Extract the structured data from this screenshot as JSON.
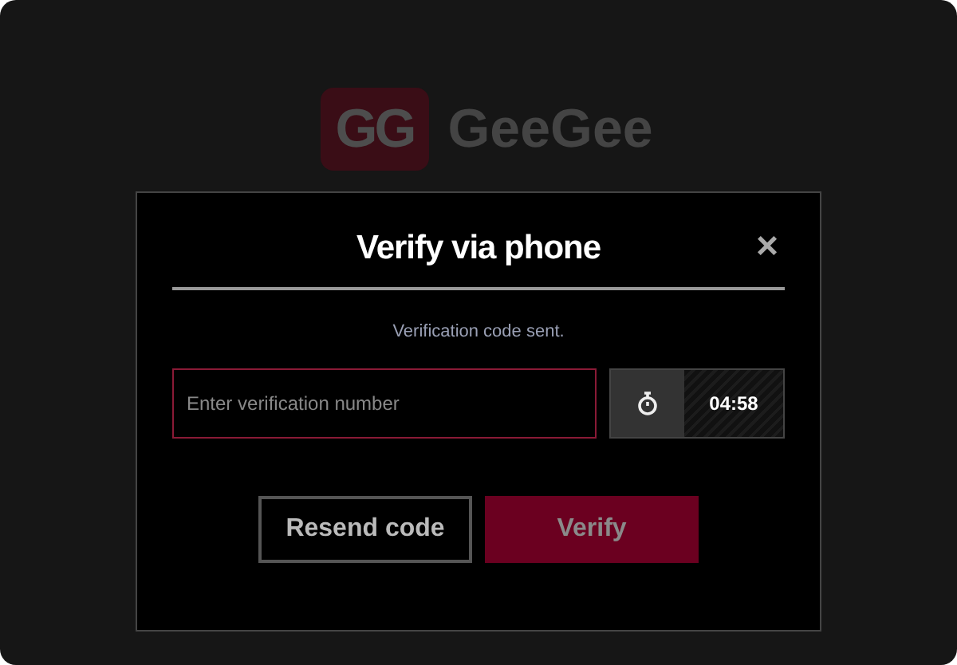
{
  "logo": {
    "mark": "GG",
    "name": "GeeGee"
  },
  "dialog": {
    "title": "Verify via phone",
    "close": "×",
    "message": "Verification code sent.",
    "code_field": {
      "placeholder": "Enter verification number"
    },
    "timer": "04:58",
    "buttons": [
      {
        "kind": "secondary",
        "label": "Resend code",
        "disabled": false
      },
      {
        "kind": "primary",
        "label": "Verify",
        "disabled": true
      }
    ]
  }
}
